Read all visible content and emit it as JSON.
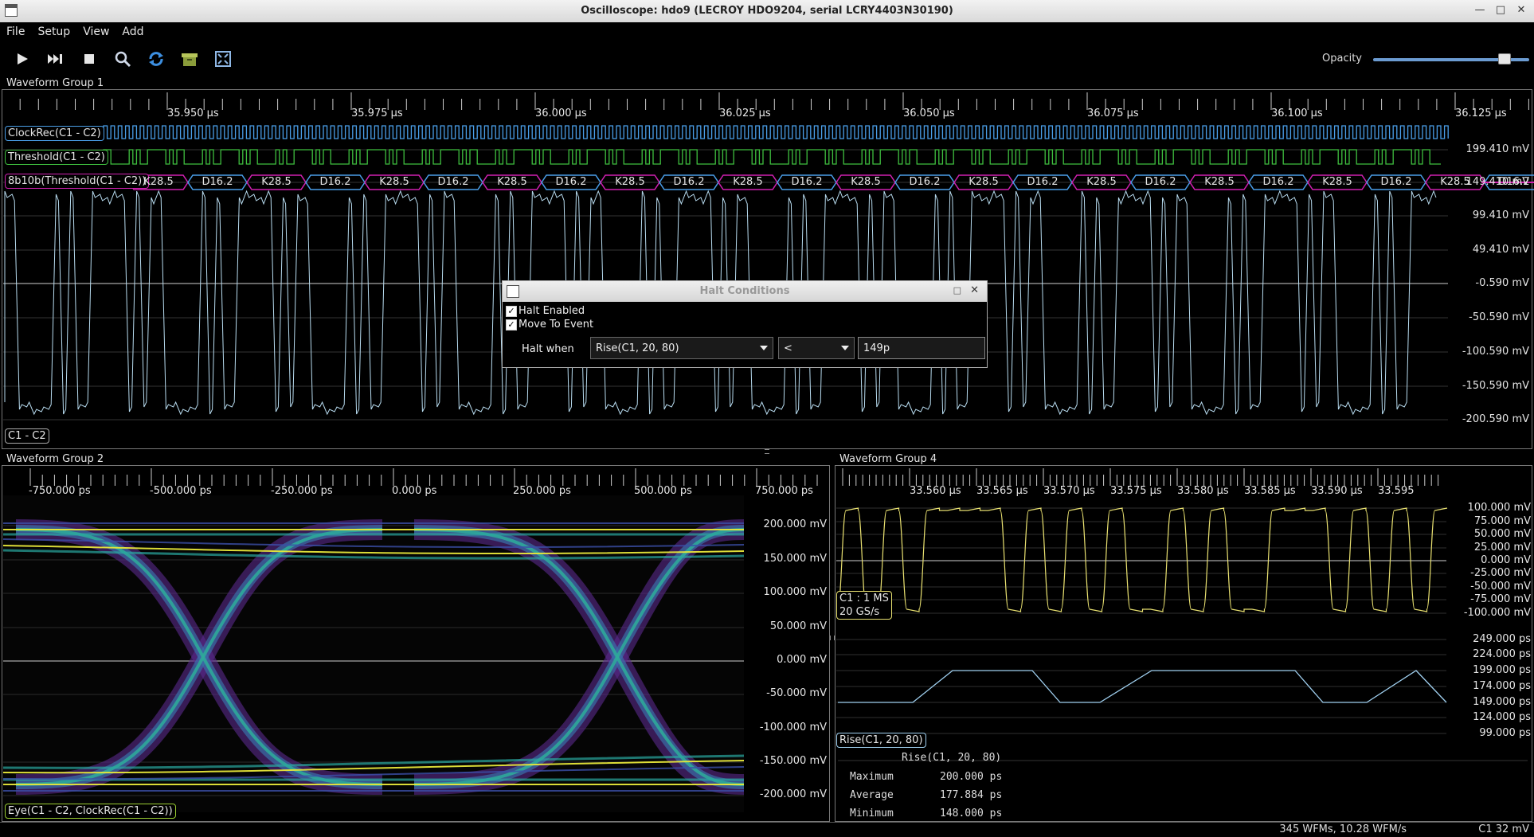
{
  "window": {
    "title": "Oscilloscope: hdo9 (LECROY HDO9204, serial LCRY4403N30190)"
  },
  "menu": [
    "File",
    "Setup",
    "View",
    "Add"
  ],
  "toolbar": {
    "icons": [
      "play-icon",
      "step-icon",
      "stop-icon",
      "zoom-icon",
      "refresh-icon",
      "clear-sweeps-icon",
      "fullscreen-icon"
    ],
    "opacity_label": "Opacity",
    "opacity_value": 0.84
  },
  "group1": {
    "label": "Waveform Group 1",
    "time_ticks": [
      "35.950 µs",
      "35.975 µs",
      "36.000 µs",
      "36.025 µs",
      "36.050 µs",
      "36.075 µs",
      "36.100 µs",
      "36.125 µs"
    ],
    "volt_ticks": [
      "199.410 mV",
      "149.410 mV",
      "99.410 mV",
      "49.410 mV",
      "-0.590 mV",
      "-50.590 mV",
      "-100.590 mV",
      "-150.590 mV",
      "-200.590 mV"
    ],
    "channels": {
      "clockrec": "ClockRec(C1 - C2)",
      "threshold": "Threshold(C1 - C2)",
      "decode": "8b10b(Threshold(C1 - C2))",
      "analog": "C1 - C2"
    },
    "symbols": [
      "K28.5",
      "D16.2",
      "K28.5",
      "D16.2",
      "K28.5",
      "D16.2",
      "K28.5",
      "D16.2",
      "K28.5",
      "D16.2",
      "K28.5",
      "D16.2",
      "K28.5",
      "D16.2",
      "K28.5",
      "D16.2",
      "K28.5",
      "D16.2",
      "K28.5",
      "D16.2",
      "K28.5",
      "D16.2",
      "K28.5",
      "D16.2"
    ]
  },
  "group2": {
    "label": "Waveform Group 2",
    "time_ticks": [
      "-750.000 ps",
      "-500.000 ps",
      "-250.000 ps",
      "0.000 ps",
      "250.000 ps",
      "500.000 ps",
      "750.000 ps"
    ],
    "volt_ticks": [
      "200.000 mV",
      "150.000 mV",
      "100.000 mV",
      "50.000 mV",
      "0.000 mV",
      "-50.000 mV",
      "-100.000 mV",
      "-150.000 mV",
      "-200.000 mV"
    ],
    "channel": "Eye(C1 - C2, ClockRec(C1 - C2))"
  },
  "group4": {
    "label": "Waveform Group 4",
    "time_ticks": [
      "33.560 µs",
      "33.565 µs",
      "33.570 µs",
      "33.575 µs",
      "33.580 µs",
      "33.585 µs",
      "33.590 µs",
      "33.595"
    ],
    "volt_ticks": [
      "100.000 mV",
      "75.000 mV",
      "50.000 mV",
      "25.000 mV",
      "0.000 mV",
      "-25.000 mV",
      "-50.000 mV",
      "-75.000 mV",
      "-100.000 mV"
    ],
    "channel_info": [
      "C1 : 1 MS",
      "20 GS/s"
    ],
    "trend_ticks": [
      "249.000 ps",
      "224.000 ps",
      "199.000 ps",
      "174.000 ps",
      "149.000 ps",
      "124.000 ps",
      "99.000 ps"
    ],
    "trend_channel": "Rise(C1, 20, 80)",
    "stats_header": "Rise(C1, 20, 80)",
    "stats": [
      {
        "name": "Maximum",
        "value": "200.000 ps"
      },
      {
        "name": "Average",
        "value": "177.884 ps"
      },
      {
        "name": "Minimum",
        "value": "148.000 ps"
      }
    ]
  },
  "dialog": {
    "title": "Halt Conditions",
    "halt_enabled_label": "Halt Enabled",
    "move_to_event_label": "Move To Event",
    "halt_when_label": "Halt when",
    "measurement": "Rise(C1, 20, 80)",
    "operator": "<",
    "value": "149p"
  },
  "status": {
    "rate": "345 WFMs, 10.28 WFM/s",
    "channel": "C1 32 mV"
  },
  "colors": {
    "clockrec": "#4a9ee8",
    "threshold": "#3fbf3f",
    "decode_k": "#d020b0",
    "decode_d": "#4a9ee8",
    "analog": "#b8dcf0",
    "group4": "#e8e070",
    "trend": "#a0d0f0"
  }
}
